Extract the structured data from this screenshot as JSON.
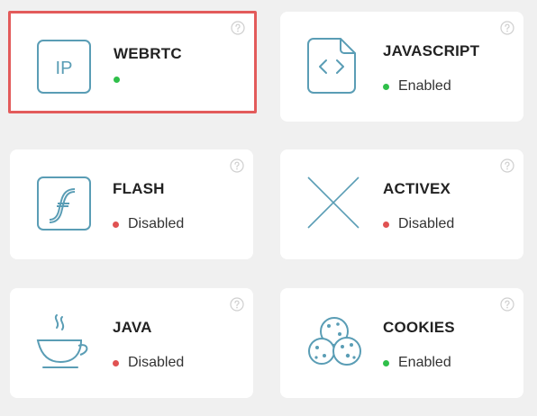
{
  "cards": [
    {
      "id": "webrtc",
      "title": "WEBRTC",
      "status": "",
      "status_color": "#2fbf4a",
      "selected": true,
      "icon": "ip-icon",
      "icon_text": "IP"
    },
    {
      "id": "javascript",
      "title": "JAVASCRIPT",
      "status": "Enabled",
      "status_color": "#2fbf4a",
      "selected": false,
      "icon": "code-file-icon"
    },
    {
      "id": "flash",
      "title": "FLASH",
      "status": "Disabled",
      "status_color": "#e05252",
      "selected": false,
      "icon": "flash-icon"
    },
    {
      "id": "activex",
      "title": "ACTIVEX",
      "status": "Disabled",
      "status_color": "#e05252",
      "selected": false,
      "icon": "activex-x-icon"
    },
    {
      "id": "java",
      "title": "JAVA",
      "status": "Disabled",
      "status_color": "#e05252",
      "selected": false,
      "icon": "coffee-cup-icon"
    },
    {
      "id": "cookies",
      "title": "COOKIES",
      "status": "Enabled",
      "status_color": "#2fbf4a",
      "selected": false,
      "icon": "cookies-icon"
    }
  ],
  "colors": {
    "icon_stroke": "#5a9db5",
    "help_stroke": "#cfcfcf",
    "selected_border": "#e35b5b"
  }
}
